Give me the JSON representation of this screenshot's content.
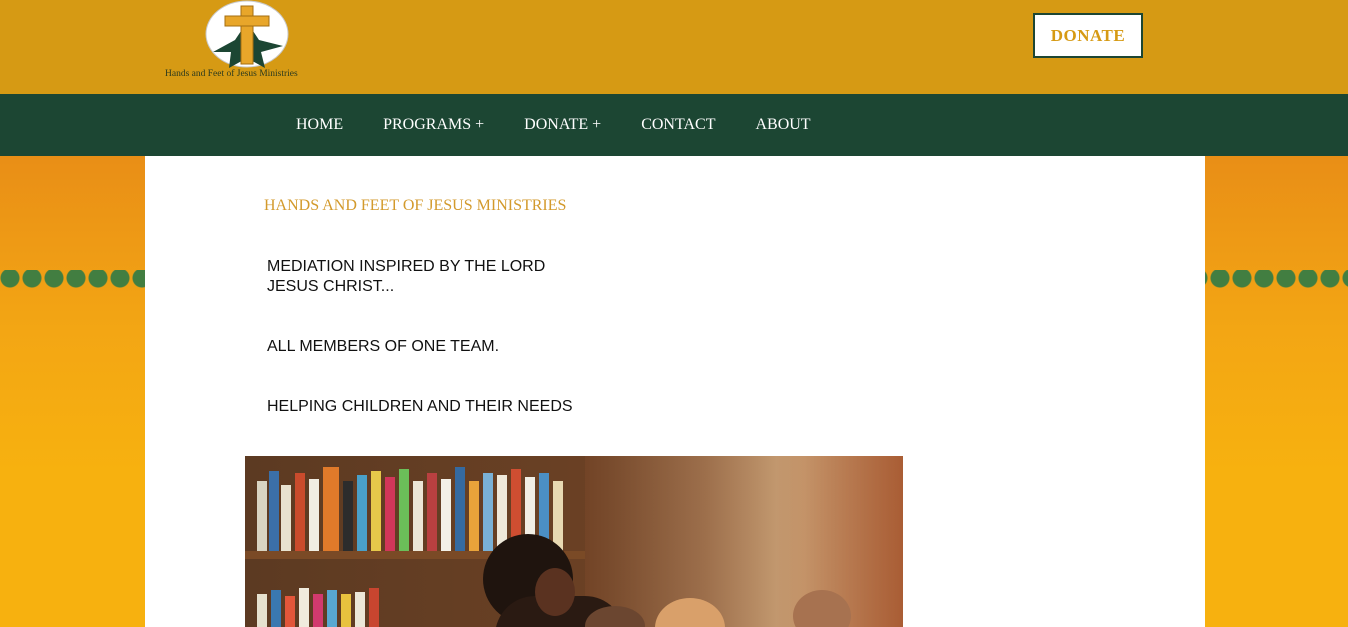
{
  "header": {
    "logo_text": "Hands and Feet of Jesus Ministries",
    "donate_label": "DONATE",
    "accent_color": "#d69a14",
    "nav_color": "#1c4633"
  },
  "nav": {
    "items": [
      "HOME",
      "PROGRAMS +",
      "DONATE +",
      "CONTACT",
      "ABOUT"
    ]
  },
  "main": {
    "title": "HANDS AND FEET OF JESUS MINISTRIES",
    "tagline_1": "MEDIATION INSPIRED BY THE LORD JESUS CHRIST...",
    "tagline_2": "ALL MEMBERS OF ONE TEAM.",
    "tagline_3": "HELPING CHILDREN AND THEIR NEEDS"
  }
}
